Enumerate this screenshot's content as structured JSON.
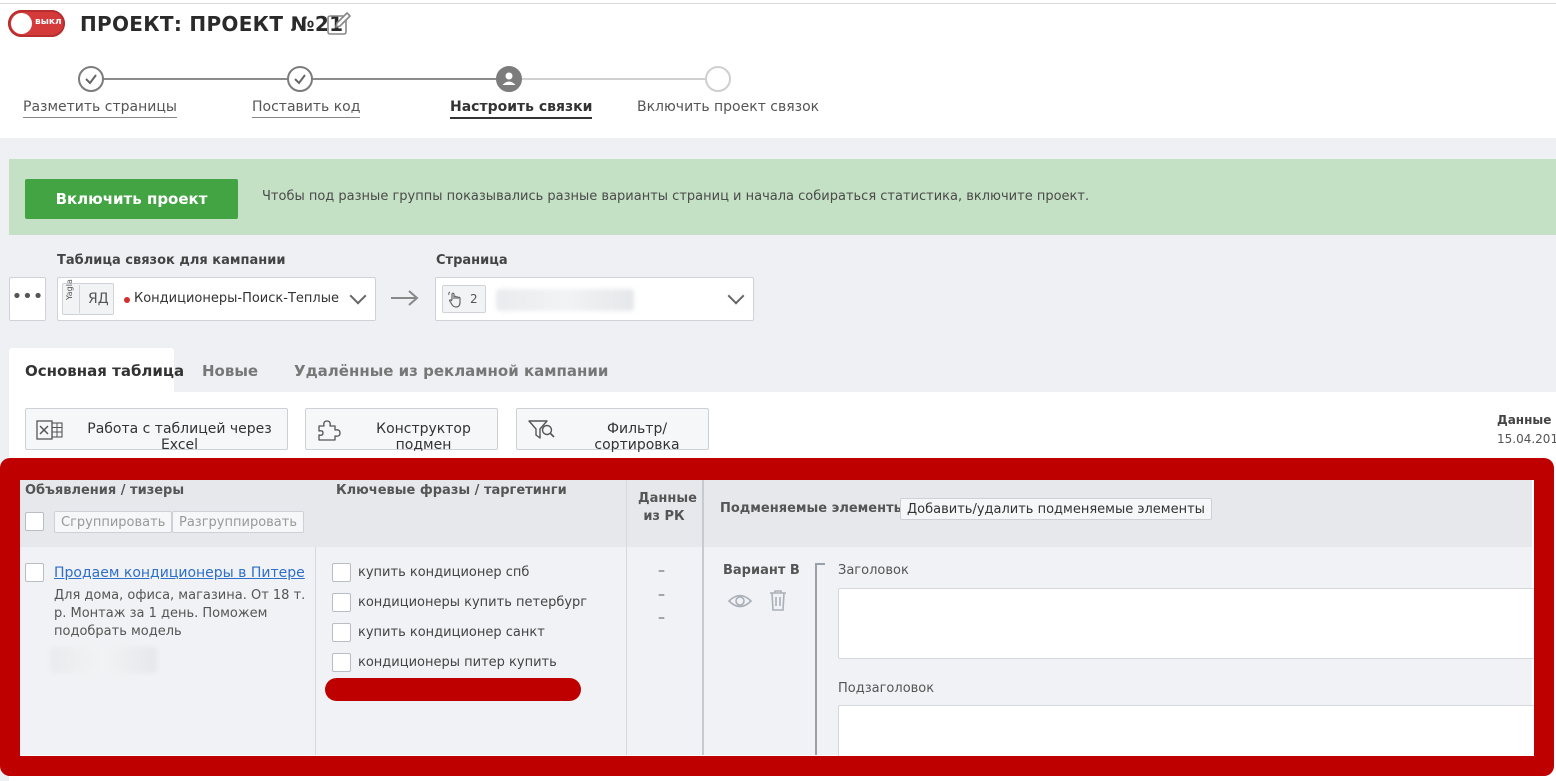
{
  "header": {
    "toggle_label": "выкл",
    "title": "ПРОЕКТ: ПРОЕКТ №21"
  },
  "steps": [
    {
      "label": "Разметить страницы",
      "state": "done"
    },
    {
      "label": "Поставить код",
      "state": "done"
    },
    {
      "label": "Настроить связки",
      "state": "active"
    },
    {
      "label": "Включить проект связок",
      "state": "todo"
    }
  ],
  "banner": {
    "button_label": "Включить проект",
    "text": "Чтобы под разные группы показывались разные варианты страниц и начала собираться статистика, включите проект."
  },
  "selectors": {
    "more_label": "•••",
    "campaign": {
      "label": "Таблица связок для кампании",
      "chip_vertical": "Yagla",
      "chip_text": "ЯД",
      "value": "Кондиционеры-Поиск-Теплые"
    },
    "arrow": "→",
    "page": {
      "label": "Страница",
      "chip_count": "2"
    }
  },
  "tabs": [
    {
      "label": "Основная таблица",
      "active": true
    },
    {
      "label": "Новые",
      "active": false
    },
    {
      "label": "Удалённые из рекламной кампании",
      "active": false
    }
  ],
  "toolbar": {
    "excel": "Работа с таблицей через Excel",
    "constructor": "Конструктор подмен",
    "filter": "Фильтр/сортировка",
    "data_label": "Данные а",
    "data_date": "15.04.201"
  },
  "table": {
    "headers": {
      "ads": "Объявления / тизеры",
      "keywords": "Ключевые фразы / таргетинги",
      "rk_line1": "Данные",
      "rk_line2": "из РК",
      "elements": "Подменяемые элементы"
    },
    "group_btn": "Сгруппировать",
    "ungroup_btn": "Разгруппировать",
    "add_remove_btn": "Добавить/удалить подменяемые элементы",
    "ad": {
      "title": "Продаем кондиционеры в Питере",
      "desc_line1": "Для дома, офиса, магазина. От 18 т.",
      "desc_line2": "р. Монтаж за 1 день. Поможем",
      "desc_line3": "подобрать модель"
    },
    "keywords": [
      "купить кондиционер спб",
      "кондиционеры купить петербург",
      "купить кондиционер санкт",
      "кондиционеры питер купить"
    ],
    "rk_values": [
      "–",
      "–",
      "–"
    ],
    "variant": {
      "label": "Вариант B",
      "field1": "Заголовок",
      "field2": "Подзаголовок"
    }
  },
  "colors": {
    "accent_green": "#43a443",
    "banner_green": "#c5e1c5",
    "annotation_red": "#bf0000",
    "link_blue": "#2e6fc9"
  }
}
